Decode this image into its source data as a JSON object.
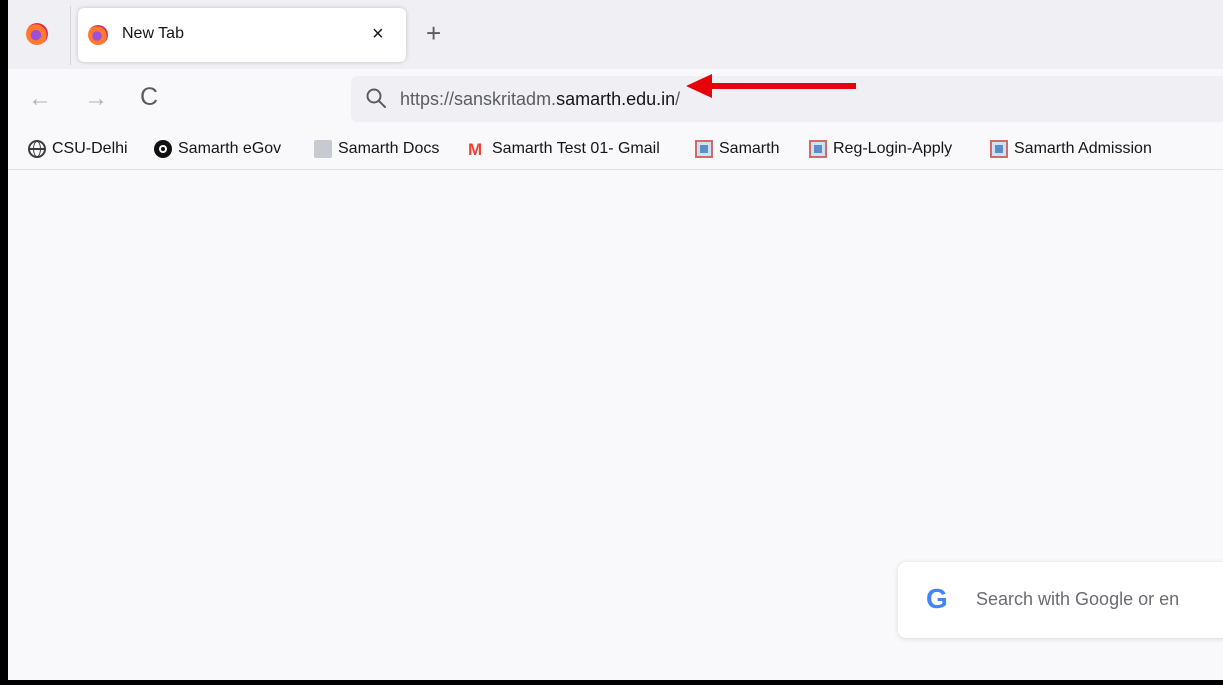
{
  "tabs": [
    {
      "title": "New Tab",
      "close_glyph": "×"
    }
  ],
  "new_tab_glyph": "+",
  "nav": {
    "back_glyph": "←",
    "forward_glyph": "→",
    "reload_glyph": "C"
  },
  "urlbar": {
    "scheme_prefix": "https://sanskritadm.",
    "host": "samarth.edu.in",
    "suffix": "/"
  },
  "bookmarks": [
    {
      "label": "CSU-Delhi",
      "icon": "globe-icon"
    },
    {
      "label": "Samarth eGov",
      "icon": "circle-logo-icon"
    },
    {
      "label": "Samarth Docs",
      "icon": "document-icon"
    },
    {
      "label": "Samarth Test 01- Gmail",
      "icon": "gmail-icon"
    },
    {
      "label": "Samarth",
      "icon": "image-icon"
    },
    {
      "label": "Reg-Login-Apply",
      "icon": "image-icon"
    },
    {
      "label": "Samarth Admission",
      "icon": "image-icon"
    }
  ],
  "search_box": {
    "logo": "G",
    "placeholder": "Search with Google or en"
  },
  "colors": {
    "annotation_arrow": "#e8000b",
    "accent": "#4285f4"
  }
}
